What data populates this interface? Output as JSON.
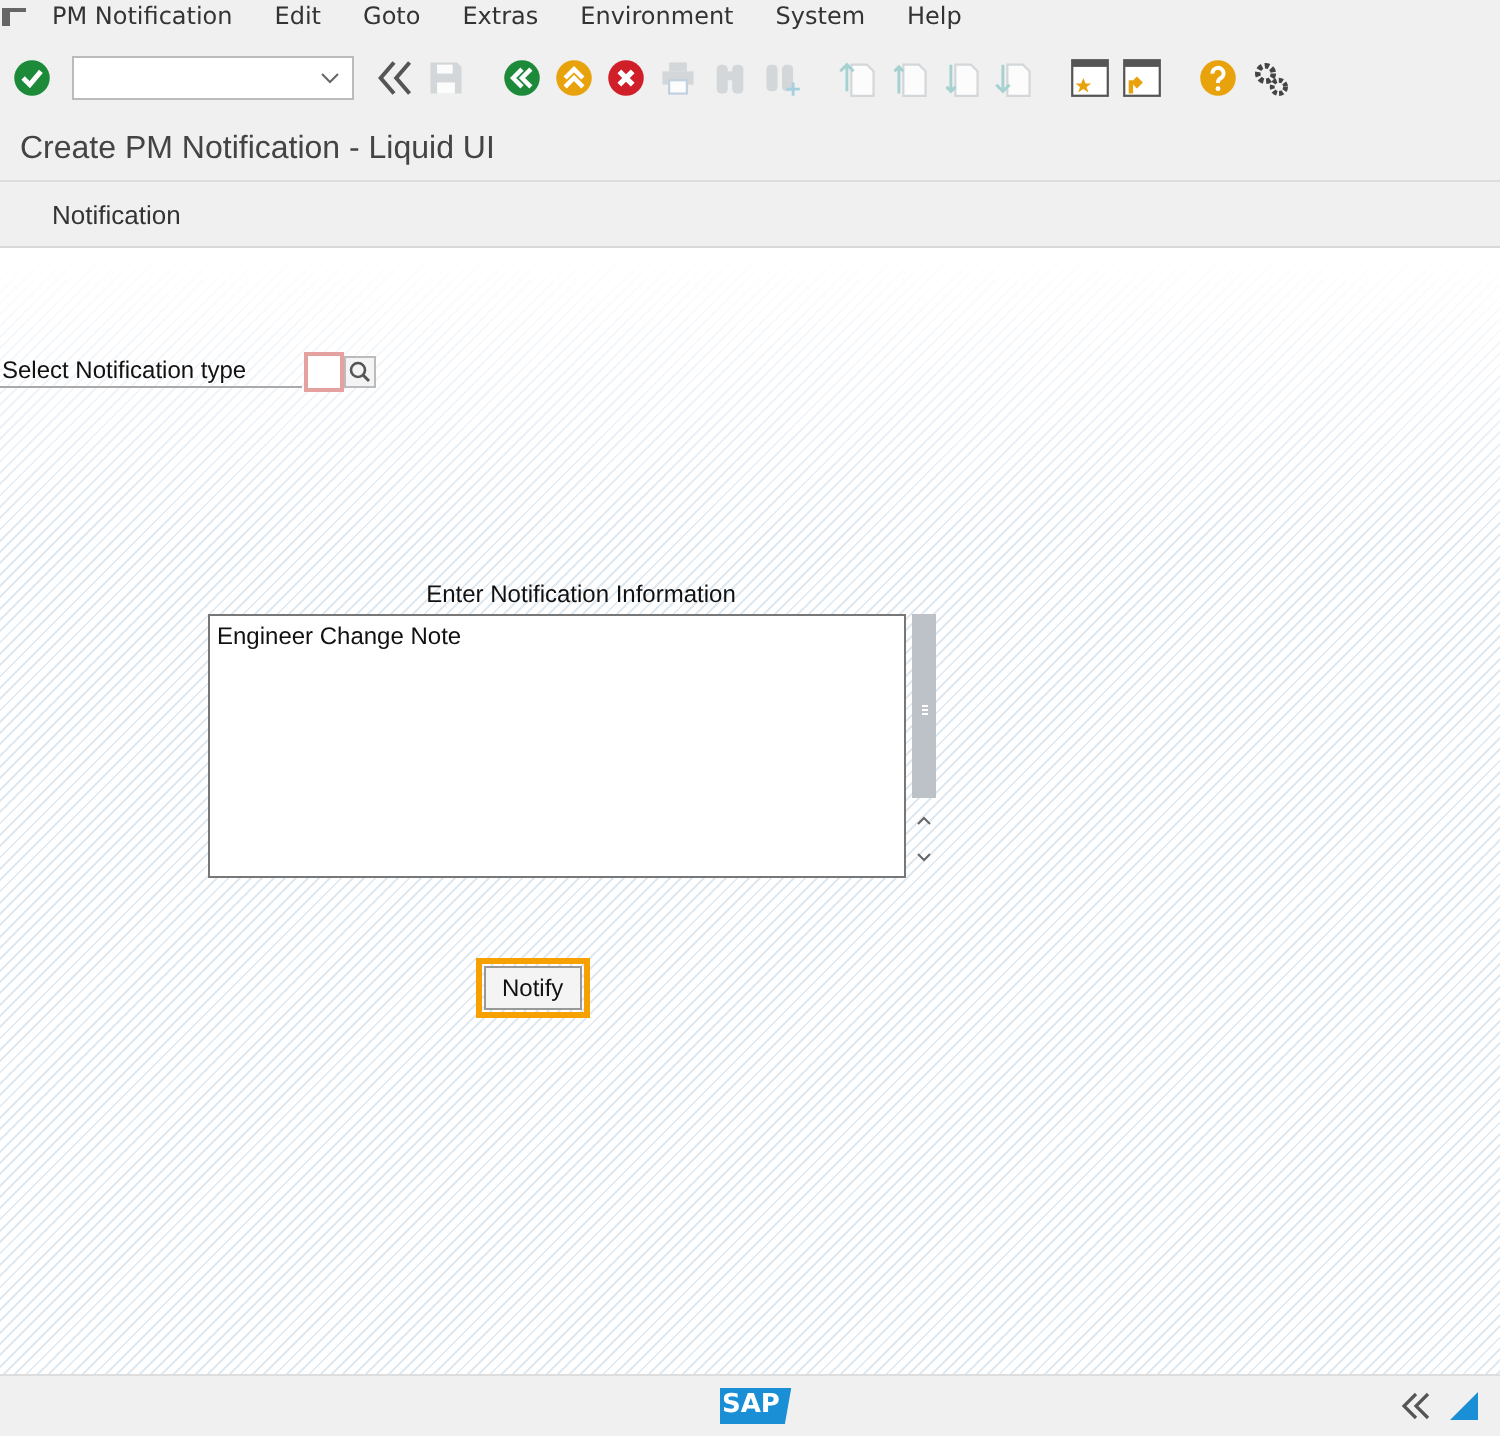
{
  "menu_bar": {
    "items": [
      "PM Notification",
      "Edit",
      "Goto",
      "Extras",
      "Environment",
      "System",
      "Help"
    ]
  },
  "toolbar": {
    "items": [
      {
        "kind": "enter",
        "disabled": false
      },
      {
        "kind": "command",
        "disabled": false
      },
      {
        "kind": "collapse",
        "disabled": false
      },
      {
        "kind": "save",
        "disabled": true
      },
      {
        "kind": "back",
        "disabled": false
      },
      {
        "kind": "exit",
        "disabled": false
      },
      {
        "kind": "cancel",
        "disabled": false
      },
      {
        "kind": "print",
        "disabled": true
      },
      {
        "kind": "find",
        "disabled": true
      },
      {
        "kind": "find-next",
        "disabled": true
      },
      {
        "kind": "first-page",
        "disabled": true
      },
      {
        "kind": "previous-page",
        "disabled": true
      },
      {
        "kind": "next-page",
        "disabled": true
      },
      {
        "kind": "last-page",
        "disabled": true
      },
      {
        "kind": "new-session",
        "disabled": false
      },
      {
        "kind": "shortcut",
        "disabled": false
      },
      {
        "kind": "help",
        "disabled": false
      },
      {
        "kind": "settings",
        "disabled": false
      }
    ]
  },
  "window": {
    "title": "Create PM Notification - Liquid UI"
  },
  "app_toolbar": {
    "items": [
      "Notification"
    ]
  },
  "form": {
    "type_label": "Select Notification type",
    "info_label": "Enter Notification Information",
    "info_text": "Engineer Change Note",
    "notify_button": "Notify"
  },
  "status_bar": {
    "logo": "SAP"
  }
}
